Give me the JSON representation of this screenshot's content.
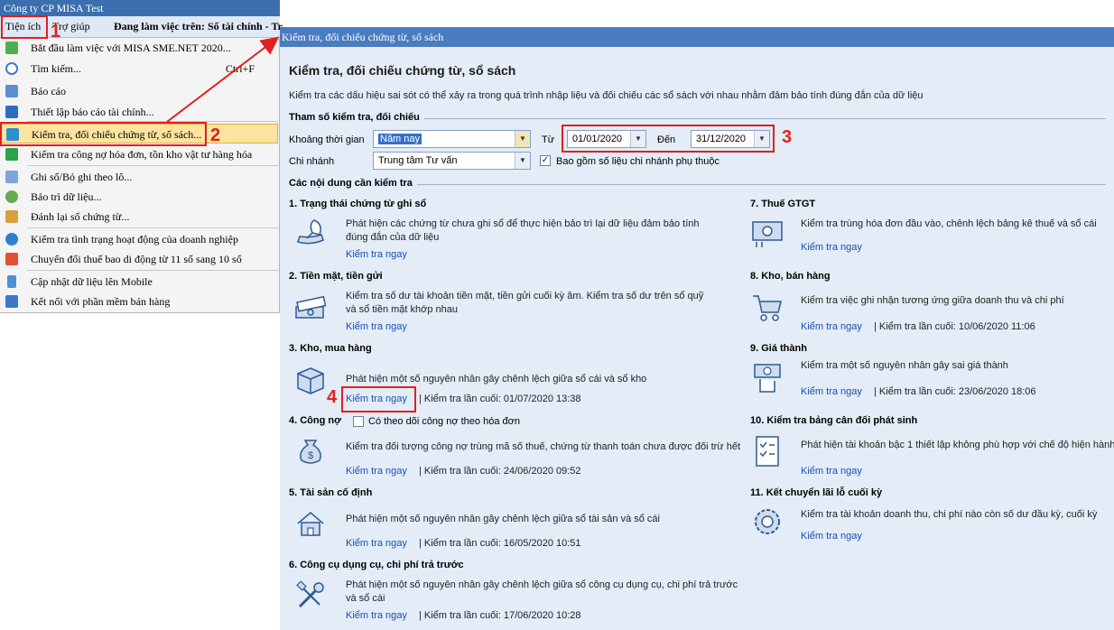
{
  "window": {
    "title": "Công ty CP MISA Test"
  },
  "menubar": {
    "tienich": "Tiện ích",
    "trogiup": "Trợ giúp",
    "working": "Đang làm việc trên: Sổ tài chính - Tr"
  },
  "menu": {
    "items": [
      {
        "label": "Bắt đầu làm việc với MISA SME.NET 2020...",
        "icon": "start-icon"
      },
      {
        "label": "Tìm kiếm...",
        "shortcut": "Ctrl+F",
        "icon": "search-icon"
      },
      {
        "label": "Báo cáo",
        "icon": "report-icon"
      },
      {
        "label": "Thiết lập báo cáo tài chính...",
        "icon": "finance-setup-icon"
      },
      {
        "label": "Kiểm tra, đối chiếu chứng từ, sổ sách...",
        "icon": "check-document-icon"
      },
      {
        "label": "Kiểm tra công nợ hóa đơn, tồn kho vật tư hàng hóa",
        "icon": "check-inventory-icon"
      },
      {
        "label": "Ghi sổ/Bỏ ghi theo lô...",
        "icon": "batch-post-icon"
      },
      {
        "label": "Bảo trì dữ liệu...",
        "icon": "maintenance-icon"
      },
      {
        "label": "Đánh lại số chứng từ...",
        "icon": "renumber-icon"
      },
      {
        "label": "Kiểm tra tình trạng hoạt động của doanh nghiệp",
        "icon": "business-status-icon"
      },
      {
        "label": "Chuyển đổi thuế bao di động từ 11 số sang 10 số",
        "icon": "phone-convert-icon"
      },
      {
        "label": "Cập nhật dữ liệu lên Mobile",
        "icon": "mobile-icon"
      },
      {
        "label": "Kết nối với phần mềm bán hàng",
        "icon": "connect-icon"
      }
    ]
  },
  "annotations": {
    "n1": "1",
    "n2": "2",
    "n3": "3",
    "n4": "4"
  },
  "panel": {
    "header": "Kiểm tra, đối chiếu chứng từ, sổ sách",
    "title": "Kiểm tra, đối chiếu chứng từ, sổ sách",
    "description": "Kiểm tra các dấu hiệu sai sót có thể xảy ra trong quá trình nhập liệu và đối chiếu các sổ sách với nhau nhằm đảm bảo tính đúng đắn của dữ liệu",
    "params_heading": "Tham số kiểm tra, đối chiếu",
    "period_label": "Khoảng thời gian",
    "period_value": "Năm nay",
    "from_label": "Từ",
    "from_value": "01/01/2020",
    "to_label": "Đến",
    "to_value": "31/12/2020",
    "branch_label": "Chi nhánh",
    "branch_value": "Trung tâm Tư vấn",
    "include_branch_label": "Bao gồm số liệu chi nhánh phụ thuộc",
    "include_branch_checked": true,
    "content_heading": "Các nội dung cần kiểm tra",
    "check_now": "Kiểm tra ngay",
    "debt_invoice_label": "Có theo dõi công nợ theo hóa đơn"
  },
  "tasks": [
    {
      "title": "1. Trạng thái chứng từ ghi sổ",
      "desc": "Phát hiện các chứng từ chưa ghi sổ để thực hiện bảo trì lại dữ liệu đảm bảo tính đúng đắn của dữ liệu",
      "last": "",
      "icon": "quill-icon"
    },
    {
      "title": "2. Tiền mặt, tiền gửi",
      "desc": "Kiểm tra số dư tài khoản tiền mặt, tiền gửi cuối kỳ âm. Kiểm tra số dư trên sổ quỹ và sổ tiền mặt khớp nhau",
      "last": "",
      "icon": "cash-icon"
    },
    {
      "title": "3. Kho, mua hàng",
      "desc": "Phát hiện một số nguyên nhân gây chênh lệch giữa sổ cái và sổ kho",
      "last": "| Kiểm tra lần cuối: 01/07/2020 13:38",
      "icon": "box-icon"
    },
    {
      "title": "4. Công nợ",
      "desc": "Kiểm tra đối tượng công nợ trùng mã số thuế, chứng từ thanh toán chưa được đối trừ hết",
      "last": "| Kiểm tra lần cuối: 24/06/2020 09:52",
      "icon": "money-bag-icon"
    },
    {
      "title": "5. Tài sản cố định",
      "desc": "Phát hiện một số nguyên nhân gây chênh lệch giữa sổ tài sản và sổ cái",
      "last": "| Kiểm tra lần cuối: 16/05/2020 10:51",
      "icon": "house-icon"
    },
    {
      "title": "6. Công cụ dụng cụ, chi phí trả trước",
      "desc": "Phát hiện một số nguyên nhân gây chênh lệch giữa sổ công cụ dụng cụ, chi phí trả trước và sổ cái",
      "last": "| Kiểm tra lần cuối: 17/06/2020 10:28",
      "icon": "tools-icon"
    },
    {
      "title": "7. Thuế GTGT",
      "desc": "Kiểm tra trùng hóa đơn đầu vào, chênh lệch bảng kê thuế và sổ cái",
      "last": "",
      "icon": "tax-icon"
    },
    {
      "title": "8. Kho, bán hàng",
      "desc": "Kiểm tra việc ghi nhận tương ứng giữa doanh thu và chi phí",
      "last": "| Kiểm tra lần cuối: 10/06/2020 11:06",
      "icon": "cart-icon"
    },
    {
      "title": "9. Giá thành",
      "desc": "Kiểm tra một số nguyên nhân gây sai giá thành",
      "last": "| Kiểm tra lần cuối: 23/06/2020 18:06",
      "icon": "hand-money-icon"
    },
    {
      "title": "10. Kiểm tra bảng cân đối phát sinh",
      "desc": "Phát hiện tài khoản bậc 1 thiết lập không phù hợp với chế độ hiện hành",
      "last": "",
      "icon": "checklist-icon"
    },
    {
      "title": "11. Kết chuyển lãi lỗ cuối kỳ",
      "desc": "Kiểm tra tài khoản doanh thu, chi phí nào còn số dư đầu kỳ, cuối kỳ",
      "last": "",
      "icon": "gear-cycle-icon"
    }
  ]
}
